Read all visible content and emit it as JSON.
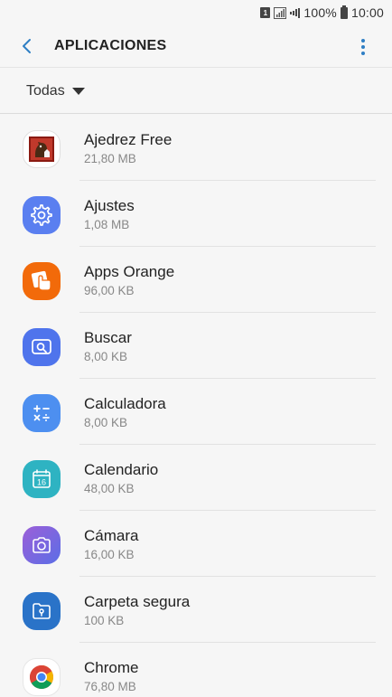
{
  "status_bar": {
    "sim": "1",
    "battery": "100%",
    "time": "10:00"
  },
  "header": {
    "title": "APLICACIONES"
  },
  "filter": {
    "label": "Todas"
  },
  "apps": [
    {
      "name": "Ajedrez Free",
      "size": "21,80 MB",
      "icon": "chess-app-icon",
      "color": "#ffffff"
    },
    {
      "name": "Ajustes",
      "size": "1,08 MB",
      "icon": "settings-gear-icon",
      "color": "#5a7ff0"
    },
    {
      "name": "Apps Orange",
      "size": "96,00 KB",
      "icon": "orange-touch-icon",
      "color": "#f26a0a"
    },
    {
      "name": "Buscar",
      "size": "8,00 KB",
      "icon": "search-finder-icon",
      "color": "#4f74ec"
    },
    {
      "name": "Calculadora",
      "size": "8,00 KB",
      "icon": "calculator-icon",
      "color": "#4d8ff0"
    },
    {
      "name": "Calendario",
      "size": "48,00 KB",
      "icon": "calendar-icon",
      "color": "#2eb3c2"
    },
    {
      "name": "Cámara",
      "size": "16,00 KB",
      "icon": "camera-icon",
      "color": "#7a63de"
    },
    {
      "name": "Carpeta segura",
      "size": "100 KB",
      "icon": "secure-folder-icon",
      "color": "#2a73c8"
    },
    {
      "name": "Chrome",
      "size": "76,80 MB",
      "icon": "chrome-icon",
      "color": "#ffffff"
    }
  ],
  "calendar_day": "16"
}
